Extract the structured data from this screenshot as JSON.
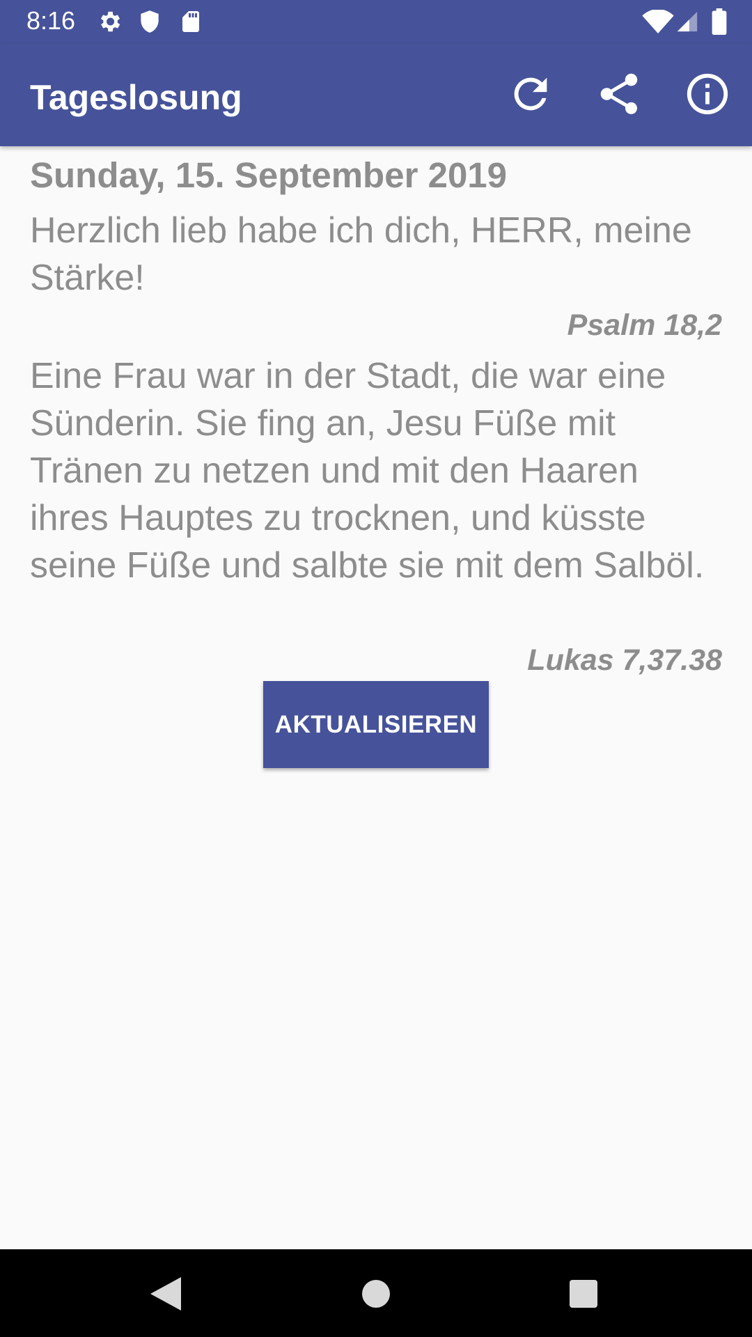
{
  "status_bar": {
    "time": "8:16",
    "left_icons": [
      "gear-icon",
      "shield-icon",
      "sd-card-icon"
    ],
    "right_icons": [
      "wifi-icon",
      "signal-icon",
      "battery-icon"
    ]
  },
  "app_bar": {
    "title": "Tageslosung",
    "actions": [
      "refresh-icon",
      "share-icon",
      "info-icon"
    ],
    "color": "#46539a"
  },
  "content": {
    "date": "Sunday, 15. September 2019",
    "losung_text": "Herzlich lieb habe ich dich, HERR, meine Stärke!",
    "losung_ref": "Psalm 18,2",
    "lehrtext_text": "Eine Frau war in der Stadt, die war eine Sünderin. Sie fing an, Jesu Füße mit Tränen zu netzen und mit den Haaren ihres Hauptes zu trocknen, und küsste seine Füße und salbte sie mit dem Salböl.",
    "lehrtext_ref": "Lukas 7,37.38",
    "text_color": "#8d8d8d"
  },
  "button": {
    "label": "AKTUALISIEREN"
  },
  "nav_bar": {
    "buttons": [
      "back-icon",
      "home-icon",
      "recents-icon"
    ]
  }
}
